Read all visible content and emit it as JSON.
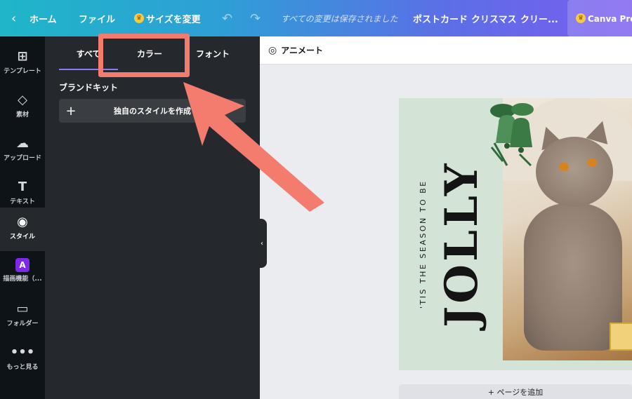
{
  "topbar": {
    "back_glyph": "‹",
    "home": "ホーム",
    "file": "ファイル",
    "resize": "サイズを変更",
    "saved_status": "すべての変更は保存されました",
    "postcard": "ポストカード",
    "christmas": "クリスマス",
    "cream": "クリー...",
    "pro": "Canva Proを"
  },
  "rail": {
    "items": [
      {
        "label": "テンプレート",
        "icon": "⊞"
      },
      {
        "label": "素材",
        "icon": "◇"
      },
      {
        "label": "アップロード",
        "icon": "☁"
      },
      {
        "label": "テキスト",
        "icon": "T"
      },
      {
        "label": "スタイル",
        "icon": "◉"
      },
      {
        "label": "描画機能（...",
        "icon": "A"
      },
      {
        "label": "フォルダー",
        "icon": "▭"
      },
      {
        "label": "もっと見る",
        "icon": "•••"
      }
    ]
  },
  "panel": {
    "tabs": [
      {
        "label": "すべて"
      },
      {
        "label": "カラー"
      },
      {
        "label": "フォント"
      }
    ],
    "brand_kit_title": "ブランドキット",
    "create_style": "独自のスタイルを作成"
  },
  "context_bar": {
    "animate": "アニメート"
  },
  "design": {
    "tagline": "'TIS THE SEASON TO BE",
    "headline": "JOLLY"
  },
  "footer": {
    "add_page": "+ ページを追加"
  },
  "colors": {
    "annotation": "#f47c6f",
    "panel_bg": "#25282d",
    "rail_bg": "#0e1318",
    "tab_underline": "#8b7cf6",
    "canvas_bg": "#d3e3d6"
  }
}
